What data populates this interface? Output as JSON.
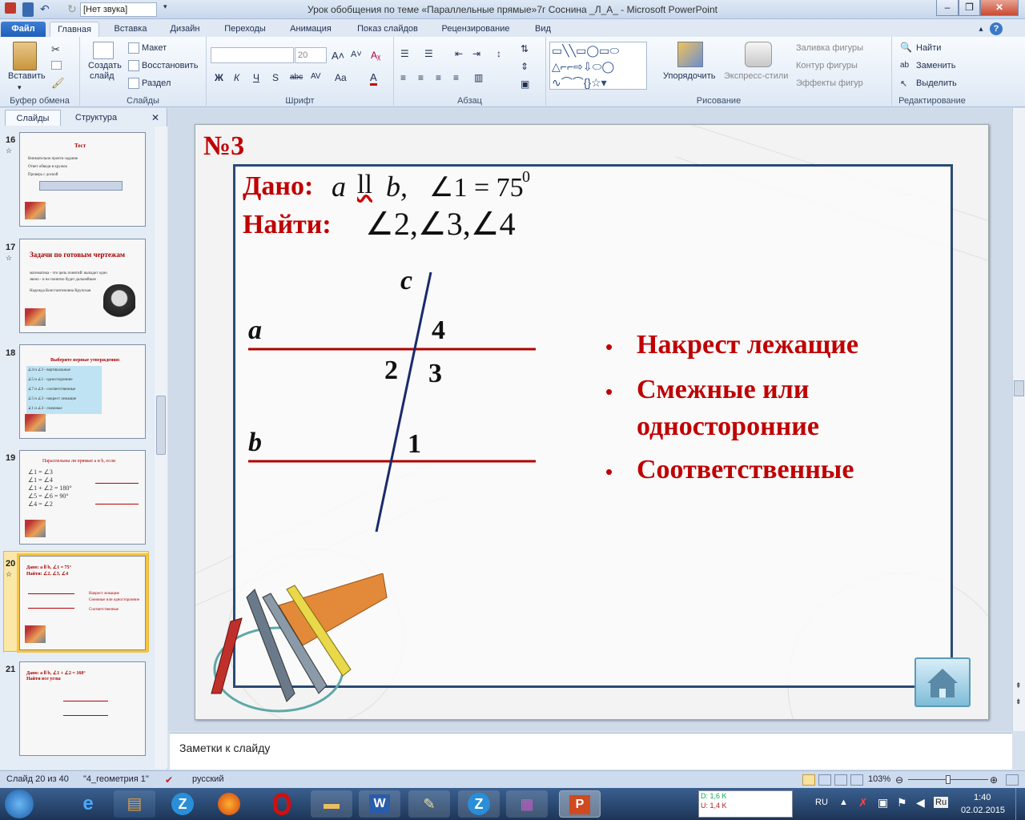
{
  "window": {
    "title": "Урок обобщения по теме «Параллельные прямые»7г Соснина _Л_А_ - Microsoft PowerPoint",
    "qat_combo": "[Нет звука]"
  },
  "tabs": [
    "Файл",
    "Главная",
    "Вставка",
    "Дизайн",
    "Переходы",
    "Анимация",
    "Показ слайдов",
    "Рецензирование",
    "Вид"
  ],
  "ribbon": {
    "clipboard": {
      "label": "Буфер обмена",
      "paste": "Вставить"
    },
    "slides": {
      "label": "Слайды",
      "create1": "Создать",
      "create2": "слайд",
      "layout": "Макет",
      "reset": "Восстановить",
      "section": "Раздел"
    },
    "font": {
      "label": "Шрифт",
      "size": "20",
      "bold": "Ж",
      "italic": "К",
      "underline": "Ч",
      "strike": "S",
      "abc": "abc",
      "spacing": "AV",
      "case": "Aa",
      "color": "A"
    },
    "paragraph": {
      "label": "Абзац"
    },
    "drawing": {
      "label": "Рисование",
      "arrange": "Упорядочить",
      "styles": "Экспресс-стили",
      "fill": "Заливка фигуры",
      "outline": "Контур фигуры",
      "effects": "Эффекты фигур"
    },
    "editing": {
      "label": "Редактирование",
      "find": "Найти",
      "replace": "Заменить",
      "select": "Выделить"
    }
  },
  "left_pane": {
    "tab_slides": "Слайды",
    "tab_outline": "Структура",
    "thumbs": [
      {
        "num": "16",
        "title": "Тест",
        "lines": [
          "Внимательно прочти задание",
          "Ответ обведи в кружок",
          "Проверь с доской"
        ]
      },
      {
        "num": "17",
        "title": "Задачи по готовым чертежам",
        "lines": [
          "математика - это цепь понятий: выпадет одно",
          "звено - и не понятно будет дальнейшее",
          "Надежда Константиновна Крупская"
        ]
      },
      {
        "num": "18",
        "title": "Выберите верные утверждения:",
        "lines": [
          "∠4 и ∠3 - вертикальные",
          "∠5 и ∠1 - односторонние",
          "∠7 и ∠6 - соответственные",
          "∠5 и ∠3 - накрест лежащие",
          "∠1 и ∠4 - смежные"
        ]
      },
      {
        "num": "19",
        "title": "Параллельны ли прямые a и b, если",
        "lines": [
          "∠1 = ∠3",
          "∠1 = ∠4",
          "∠1 + ∠2 = 180°",
          "∠5 = ∠6 = 90°",
          "∠4 = ∠2"
        ]
      },
      {
        "num": "20",
        "title": "Дано: a ll b, ∠1 = 75°",
        "lines": [
          "Найти: ∠2, ∠3, ∠4",
          "Накрест лежащие",
          "Смежные или односторонние",
          "Соответственные"
        ]
      },
      {
        "num": "21",
        "title": "Дано: a ll b, ∠1 + ∠2 = 160°",
        "lines": [
          "Найти все углы"
        ]
      }
    ]
  },
  "slide": {
    "number_label": "№3",
    "given_label": "Дано:",
    "given_expr_a": "a",
    "given_expr_parallel": "ll",
    "given_expr_b": "b,",
    "given_angle": "∠1 = 75",
    "given_degree": "0",
    "find_label": "Найти:",
    "find_expr": "∠2,∠3,∠4",
    "diagram": {
      "line_c": "c",
      "line_a": "a",
      "line_b": "b",
      "angle1": "1",
      "angle2": "2",
      "angle3": "3",
      "angle4": "4"
    },
    "bullets": [
      "Накрест лежащие",
      "Смежные или",
      "односторонние",
      "Соответственные"
    ],
    "colors": {
      "red": "#c00000",
      "frame": "#2b4a74",
      "line_ab": "#b00000",
      "line_c": "#1a2a6c"
    }
  },
  "notes": "Заметки к слайду",
  "status": {
    "slide": "Слайд 20 из 40",
    "theme": "\"4_геометрия 1\"",
    "language": "русский",
    "zoom": "103%"
  },
  "taskbar": {
    "lang": "RU",
    "time": "1:40",
    "date": "02.02.2015",
    "net_down": "D: 1,6 K",
    "net_up": "U: 1,4 K",
    "tray_ru": "Ru"
  }
}
